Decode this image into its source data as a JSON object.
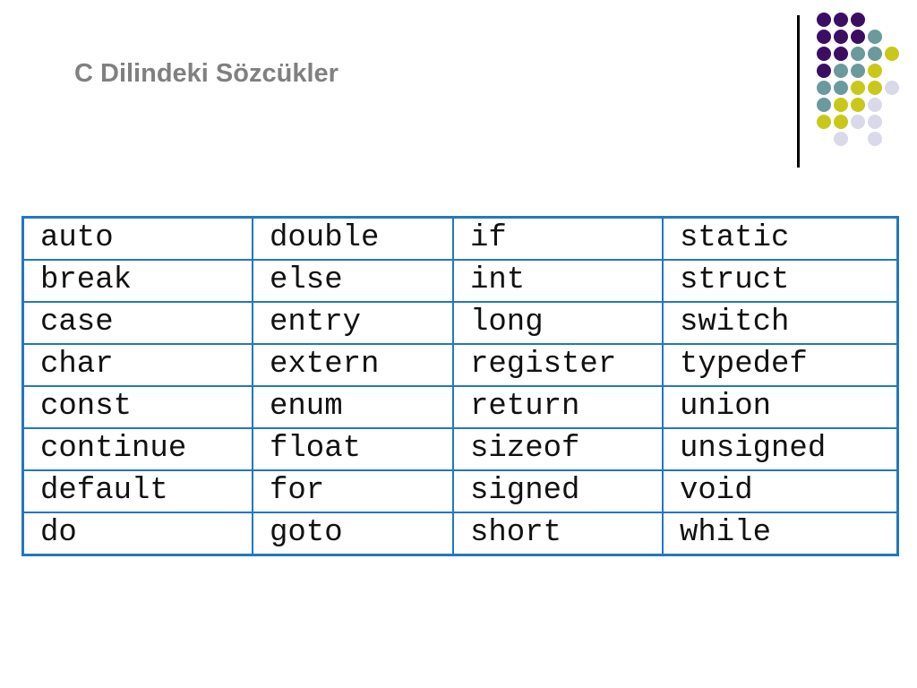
{
  "slide": {
    "title": "C Dilindeki Sözcükler"
  },
  "decoration": {
    "colors": {
      "purple": "#3b0e63",
      "teal": "#6b9a9c",
      "yellow": "#c9c81a",
      "lavender": "#d9d9ea",
      "table_border": "#2177c4",
      "title": "#808080"
    },
    "dot_grid": [
      [
        "purple",
        "purple",
        "purple",
        null,
        null
      ],
      [
        "purple",
        "purple",
        "purple",
        "teal",
        null
      ],
      [
        "purple",
        "purple",
        "teal",
        "teal",
        "yellow"
      ],
      [
        "purple",
        "teal",
        "teal",
        "yellow",
        null
      ],
      [
        "teal",
        "teal",
        "yellow",
        "yellow",
        "lavender"
      ],
      [
        "teal",
        "yellow",
        "yellow",
        "lavender",
        null
      ],
      [
        "yellow",
        "yellow",
        "lavender",
        "lavender",
        null
      ],
      [
        null,
        "lavender",
        null,
        "lavender",
        null
      ]
    ]
  },
  "keywords_table": {
    "rows": [
      [
        "auto",
        "double",
        "if",
        "static"
      ],
      [
        "break",
        "else",
        "int",
        "struct"
      ],
      [
        "case",
        "entry",
        "long",
        "switch"
      ],
      [
        "char",
        "extern",
        "register",
        "typedef"
      ],
      [
        "const",
        "enum",
        "return",
        "union"
      ],
      [
        "continue",
        "float",
        "sizeof",
        "unsigned"
      ],
      [
        "default",
        "for",
        "signed",
        "void"
      ],
      [
        "do",
        "goto",
        "short",
        "while"
      ]
    ]
  }
}
